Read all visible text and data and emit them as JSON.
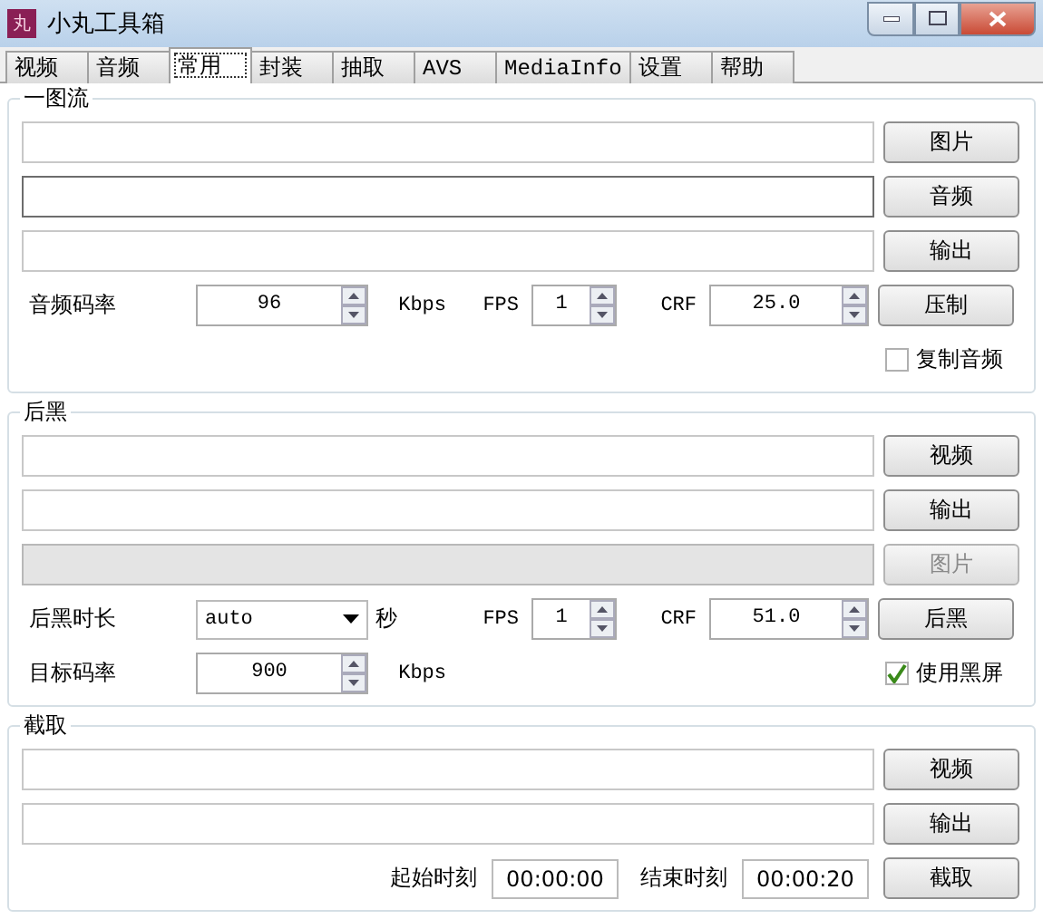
{
  "window": {
    "title": "小丸工具箱",
    "icon_text": "丸"
  },
  "tabs": [
    {
      "label": "视频",
      "selected": false
    },
    {
      "label": "音频",
      "selected": false
    },
    {
      "label": "常用",
      "selected": true
    },
    {
      "label": "封装",
      "selected": false
    },
    {
      "label": "抽取",
      "selected": false
    },
    {
      "label": "AVS",
      "selected": false
    },
    {
      "label": "MediaInfo",
      "selected": false
    },
    {
      "label": "设置",
      "selected": false
    },
    {
      "label": "帮助",
      "selected": false
    }
  ],
  "sections": [
    {
      "title": "一图流",
      "rows": [
        {
          "kind": "file",
          "button": "图片",
          "focused": false,
          "disabled": false
        },
        {
          "kind": "file",
          "button": "音频",
          "focused": true,
          "disabled": false
        },
        {
          "kind": "file",
          "button": "输出",
          "focused": false,
          "disabled": false
        },
        {
          "kind": "params",
          "items": [
            {
              "kind": "label",
              "text": "音频码率"
            },
            {
              "kind": "spin",
              "value": "96"
            },
            {
              "kind": "unit",
              "text": "Kbps"
            },
            {
              "kind": "unit",
              "text": "FPS"
            },
            {
              "kind": "spin",
              "value": "1"
            },
            {
              "kind": "unit",
              "text": "CRF"
            },
            {
              "kind": "spin",
              "value": "25.0"
            },
            {
              "kind": "button",
              "text": "压制"
            }
          ]
        },
        {
          "kind": "params",
          "items": [
            {
              "kind": "checkbox",
              "text": "复制音频",
              "checked": false
            }
          ]
        }
      ]
    },
    {
      "title": "后黑",
      "rows": [
        {
          "kind": "file",
          "button": "视频",
          "focused": false,
          "disabled": false
        },
        {
          "kind": "file",
          "button": "输出",
          "focused": false,
          "disabled": false
        },
        {
          "kind": "file",
          "button": "图片",
          "focused": false,
          "disabled": true
        },
        {
          "kind": "params",
          "items": [
            {
              "kind": "label",
              "text": "后黑时长"
            },
            {
              "kind": "combo",
              "value": "auto"
            },
            {
              "kind": "label",
              "text": "秒"
            },
            {
              "kind": "unit",
              "text": "FPS"
            },
            {
              "kind": "spin",
              "value": "1"
            },
            {
              "kind": "unit",
              "text": "CRF"
            },
            {
              "kind": "spin",
              "value": "51.0"
            },
            {
              "kind": "button",
              "text": "后黑"
            }
          ]
        },
        {
          "kind": "params",
          "items": [
            {
              "kind": "label",
              "text": "目标码率"
            },
            {
              "kind": "spin",
              "value": "900"
            },
            {
              "kind": "unit",
              "text": "Kbps"
            },
            {
              "kind": "checkbox",
              "text": "使用黑屏",
              "checked": true
            }
          ]
        }
      ]
    },
    {
      "title": "截取",
      "rows": [
        {
          "kind": "file",
          "button": "视频",
          "focused": false,
          "disabled": false
        },
        {
          "kind": "file",
          "button": "输出",
          "focused": false,
          "disabled": false
        },
        {
          "kind": "range",
          "items": [
            {
              "kind": "label",
              "text": "起始时刻"
            },
            {
              "kind": "time",
              "value": "00:00:00"
            },
            {
              "kind": "label",
              "text": "结束时刻"
            },
            {
              "kind": "time",
              "value": "00:00:20"
            },
            {
              "kind": "button",
              "text": "截取"
            }
          ]
        }
      ]
    }
  ]
}
